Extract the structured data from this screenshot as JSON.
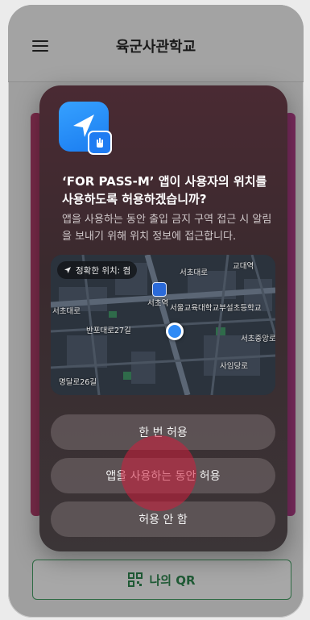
{
  "app": {
    "title": "육군사관학교"
  },
  "qr_button": {
    "label": "나의 QR"
  },
  "dialog": {
    "title": "‘FOR PASS-M’ 앱이 사용자의 위치를 사용하도록 허용하겠습니까?",
    "body": "앱을 사용하는 동안 출입 금지 구역 접근 시 알림을 보내기 위해 위치 정보에 접근합니다.",
    "precise_location": "정확한 위치: 켬",
    "map_labels": {
      "seocho_station": "서초역",
      "seochodaero": "서초대로",
      "seochodaero_left": "서초대로",
      "banpodaero27": "반포대로27길",
      "gyodae": "교대역",
      "school": "서울교육대학교부설초등학교",
      "seocho_jungang": "서초중앙로",
      "myeongdal26": "명달로26길",
      "saimdang": "사임당로"
    },
    "buttons": {
      "allow_once": "한 번 허용",
      "allow_while_using": "앱을 사용하는 동안 허용",
      "dont_allow": "허용 안 함"
    }
  },
  "colors": {
    "accent": "#1f5a35",
    "dialog_bg": "#3a2a2e",
    "location_dot": "#2f8af5",
    "touch_indicator": "#d21e3c"
  }
}
